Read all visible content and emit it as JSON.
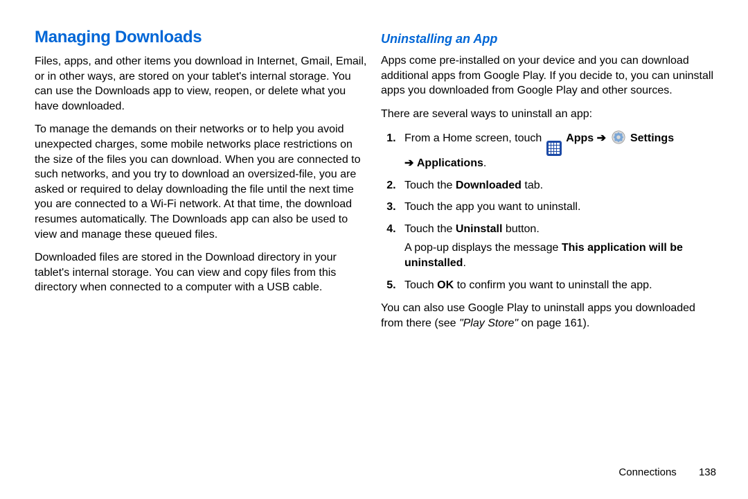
{
  "left": {
    "heading": "Managing Downloads",
    "p1": "Files, apps, and other items you download in Internet, Gmail, Email, or in other ways, are stored on your tablet's internal storage. You can use the Downloads app to view, reopen, or delete what you have downloaded.",
    "p2": "To manage the demands on their networks or to help you avoid unexpected charges, some mobile networks place restrictions on the size of the files you can download. When you are connected to such networks, and you try to download an oversized-file, you are asked or required to delay downloading the file until the next time you are connected to a Wi-Fi network. At that time, the download resumes automatically. The Downloads app can also be used to view and manage these queued files.",
    "p3": "Downloaded files are stored in the Download directory in your tablet's internal storage. You can view and copy files from this directory when connected to a computer with a USB cable."
  },
  "right": {
    "subheading": "Uninstalling an App",
    "p1": "Apps come pre-installed on your device and you can download additional apps from Google Play. If you decide to, you can uninstall apps you downloaded from Google Play and other sources.",
    "p2": "There are several ways to uninstall an app:",
    "step1_pre": "From a Home screen, touch",
    "step1_apps": "Apps",
    "step1_arrow": "➔",
    "step1_settings": "Settings",
    "step1_cont_arrow": "➔",
    "step1_applications": "Applications",
    "step2_pre": "Touch the ",
    "step2_bold": "Downloaded",
    "step2_post": " tab.",
    "step3": "Touch the app you want to uninstall.",
    "step4_pre": "Touch the ",
    "step4_bold": "Uninstall",
    "step4_post": " button.",
    "step4_extra_pre": "A pop-up displays the message ",
    "step4_extra_bold": "This application will be uninstalled",
    "step4_extra_post": ".",
    "step5_pre": "Touch ",
    "step5_bold": "OK",
    "step5_post": " to confirm you want to uninstall the app.",
    "closing_pre": "You can also use Google Play to uninstall apps you downloaded from there (see ",
    "closing_ref": "\"Play Store\"",
    "closing_post": " on page 161)."
  },
  "footer": {
    "section": "Connections",
    "page": "138"
  }
}
